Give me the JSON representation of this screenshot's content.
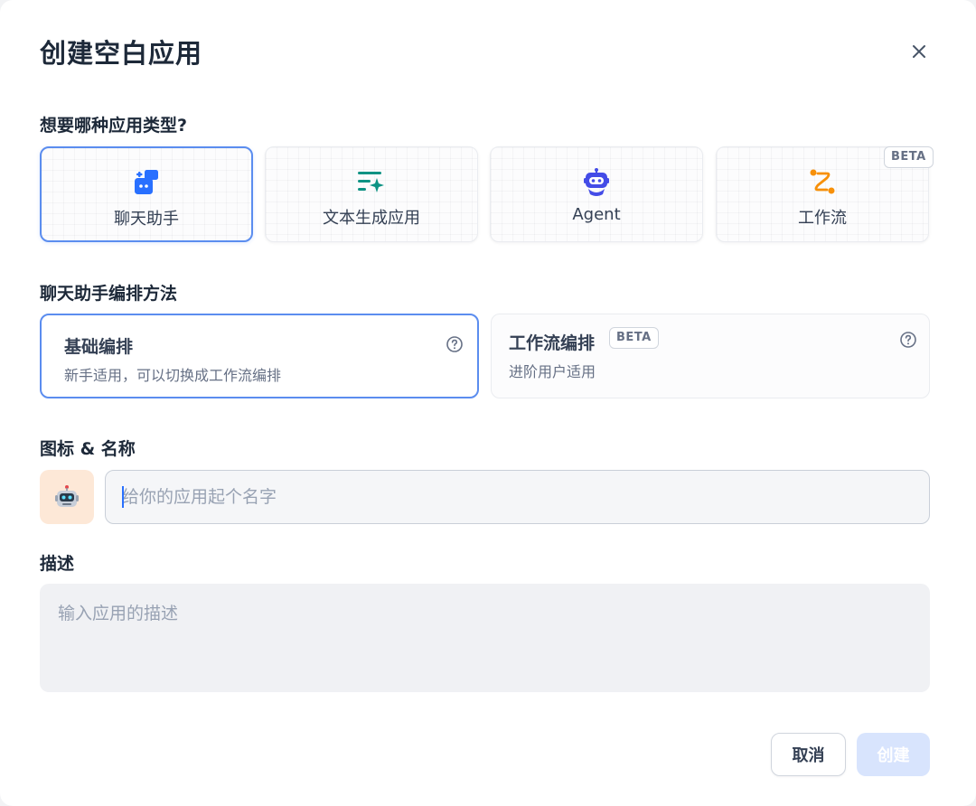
{
  "dialog": {
    "title": "创建空白应用",
    "close_icon": "close-icon"
  },
  "app_type": {
    "label": "想要哪种应用类型?",
    "options": [
      {
        "label": "聊天助手",
        "icon": "chat-bubble-icon",
        "color": "#2970ff",
        "selected": true
      },
      {
        "label": "文本生成应用",
        "icon": "text-sparkle-icon",
        "color": "#0e9384",
        "selected": false
      },
      {
        "label": "Agent",
        "icon": "robot-icon",
        "color": "#444ce7",
        "selected": false
      },
      {
        "label": "工作流",
        "icon": "workflow-route-icon",
        "color": "#f79009",
        "selected": false,
        "badge": "BETA"
      }
    ]
  },
  "orchestration": {
    "label": "聊天助手编排方法",
    "options": [
      {
        "title": "基础编排",
        "description": "新手适用，可以切换成工作流编排",
        "selected": true
      },
      {
        "title": "工作流编排",
        "badge": "BETA",
        "description": "进阶用户适用",
        "selected": false
      }
    ]
  },
  "identity": {
    "label": "图标 & 名称",
    "icon": "robot-emoji",
    "icon_bg": "#fde8d7",
    "name_placeholder": "给你的应用起个名字",
    "name_value": ""
  },
  "description": {
    "label": "描述",
    "placeholder": "输入应用的描述",
    "value": ""
  },
  "actions": {
    "cancel_label": "取消",
    "create_label": "创建",
    "create_disabled": true
  },
  "colors": {
    "accent": "#2970ff",
    "selected_border": "#5b8def",
    "disabled_button": "#d8e4fd"
  }
}
